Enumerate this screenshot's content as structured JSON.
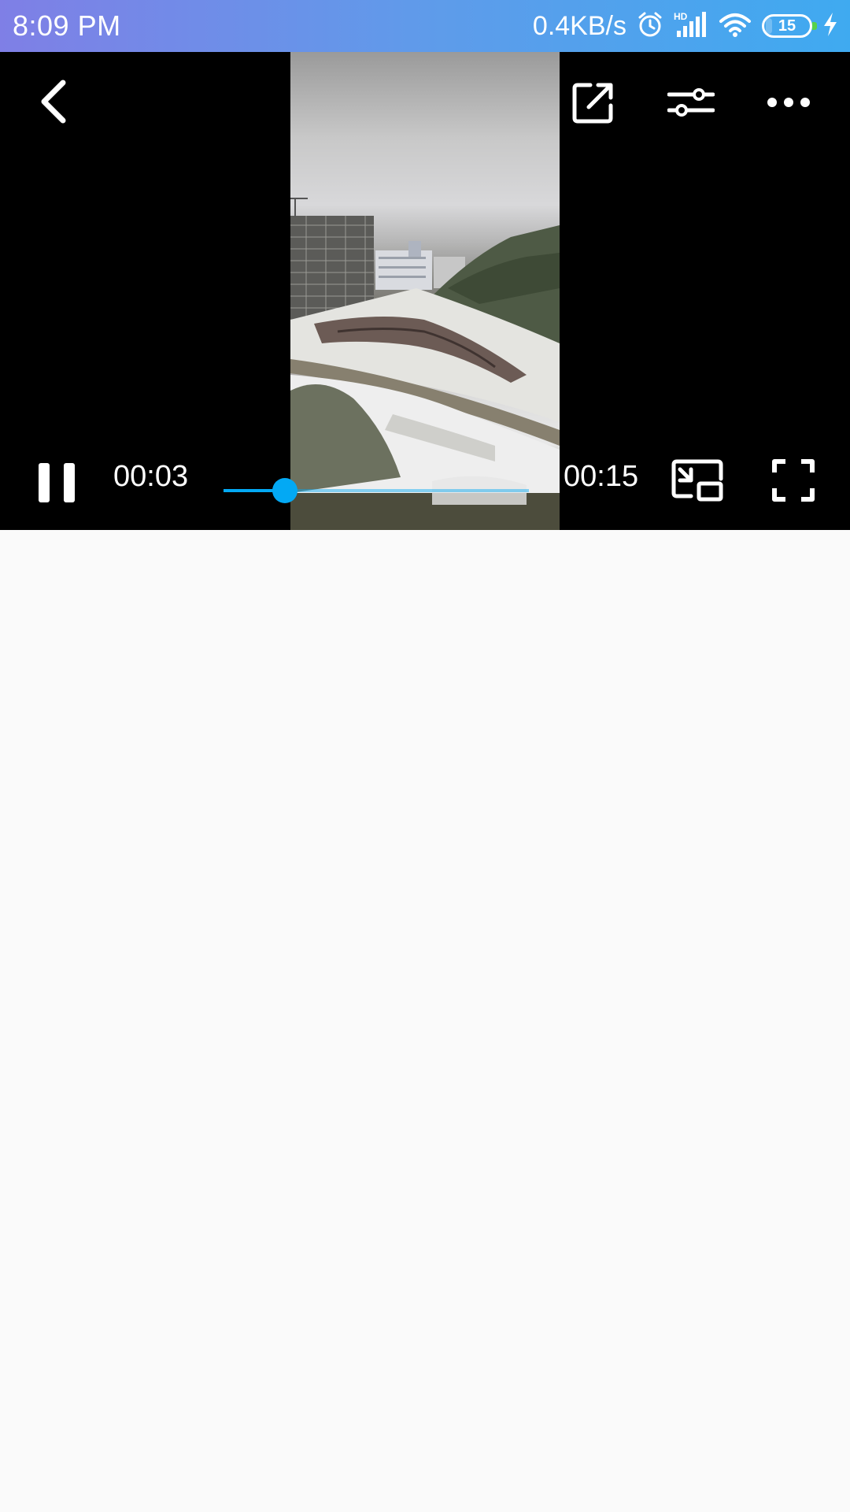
{
  "status_bar": {
    "time": "8:09 PM",
    "net_speed": "0.4KB/s",
    "battery_level": "15",
    "battery_fraction": 0.15,
    "icons": [
      "alarm-icon",
      "hd-signal-icon",
      "wifi-icon",
      "battery-icon",
      "charging-icon"
    ]
  },
  "player": {
    "current_time": "00:03",
    "total_time": "00:15",
    "progress_fraction": 0.2,
    "accent_color": "#03a9f4",
    "top_controls": [
      "back-icon",
      "open-external-icon",
      "settings-sliders-icon",
      "more-icon"
    ],
    "bottom_controls": [
      "pause-icon",
      "picture-in-picture-icon",
      "fullscreen-icon"
    ]
  }
}
